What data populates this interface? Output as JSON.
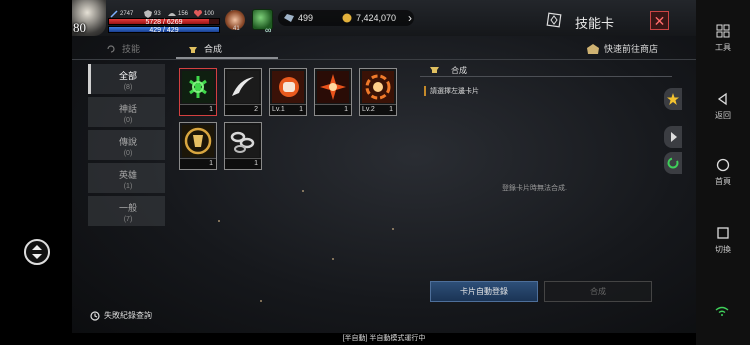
{
  "player": {
    "level": "80",
    "stat1": "2747",
    "stat2": "93",
    "stat3": "156",
    "stat4": "100",
    "hp": "5728 / 6269",
    "hp_fraction": 0.91,
    "mp": "429 / 429",
    "mp_fraction": 1.0,
    "buff1_count": "41",
    "buff2_label": "∞"
  },
  "currency": {
    "gems": "499",
    "gold": "7,424,070"
  },
  "window": {
    "title": "技能卡",
    "close": "✕"
  },
  "tabs": [
    {
      "label": "技能"
    },
    {
      "label": "合成"
    }
  ],
  "shop_link": "快速前往商店",
  "categories": [
    {
      "name": "全部",
      "count": "(8)"
    },
    {
      "name": "神話",
      "count": "(0)"
    },
    {
      "name": "傳說",
      "count": "(0)"
    },
    {
      "name": "英雄",
      "count": "(1)"
    },
    {
      "name": "一般",
      "count": "(7)"
    }
  ],
  "cards": [
    {
      "lv": "",
      "count": "1",
      "icon": "green-seal-icon"
    },
    {
      "lv": "",
      "count": "2",
      "icon": "wind-slash-icon"
    },
    {
      "lv": "Lv.1",
      "count": "1",
      "icon": "fire-fist-icon"
    },
    {
      "lv": "",
      "count": "1",
      "icon": "fire-burst-icon"
    },
    {
      "lv": "Lv.2",
      "count": "1",
      "icon": "fire-vortex-icon"
    },
    {
      "lv": "",
      "count": "1",
      "icon": "gold-emblem-icon"
    },
    {
      "lv": "",
      "count": "1",
      "icon": "chain-icon"
    }
  ],
  "synth": {
    "header": "合成",
    "hint": "請選擇左邊卡片",
    "empty": "登錄卡片時無法合成.",
    "auto_register": "卡片自動登錄",
    "craft": "合成"
  },
  "fail_log": "失敗紀錄查詢",
  "status_bar": "[半自動] 半自動模式運行中",
  "system": {
    "tools": "工具",
    "back": "返回",
    "home": "首頁",
    "switch": "切換"
  },
  "colors": {
    "hp": "#d22e2e",
    "mp": "#2f6fd0",
    "selected_card_border": "#d34040",
    "register_button": "#2e4f78"
  }
}
